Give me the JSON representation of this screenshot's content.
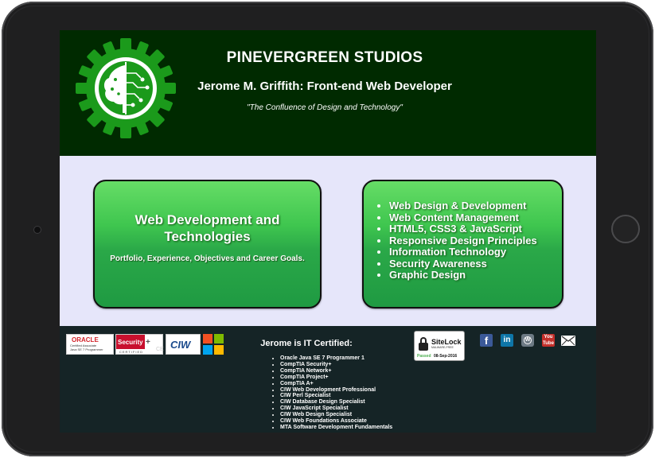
{
  "header": {
    "title": "PINEVERGREEN STUDIOS",
    "subtitle": "Jerome M. Griffith: Front-end Web Developer",
    "tagline": "\"The Confluence of Design and Technology\""
  },
  "panel_left": {
    "title_line1": "Web Development and",
    "title_line2": "Technologies",
    "description": "Portfolio, Experience, Objectives and Career Goals."
  },
  "skills": [
    "Web Design & Development",
    "Web Content Management",
    "HTML5, CSS3 & JavaScript",
    "Responsive Design Principles",
    "Information Technology",
    "Security Awareness",
    "Graphic Design"
  ],
  "footer": {
    "cert_heading": "Jerome is IT Certified:",
    "certifications": [
      "Oracle Java SE 7 Programmer 1",
      "CompTIA Security+",
      "CompTIA Network+",
      "CompTIA Project+",
      "CompTIA A+",
      "CIW Web Development Professional",
      "CIW Perl Specialist",
      "CIW Database Design Specialist",
      "CIW JavaScript Specialist",
      "CIW Web Design Specialist",
      "CIW Web Foundations Associate",
      "MTA Software Development Fundamentals"
    ],
    "badges": {
      "oracle": "ORACLE",
      "oracle_line1": "Certified Associate",
      "oracle_line2": "Java SE 7 Programmer",
      "security": "Security",
      "security_plus": "+",
      "security_cert": "CERTIFIED",
      "ce": "CE",
      "ciw": "CIW"
    },
    "sitelock": {
      "brand": "SiteLock",
      "sub": "MALWARE-FREE",
      "passed": "Passed",
      "date": "08-Sep-2016"
    },
    "social": {
      "facebook": "f",
      "linkedin": "in",
      "wordpress": "W",
      "youtube": "You Tube"
    }
  },
  "colors": {
    "header_bg": "#002a00",
    "content_bg": "#e6e6fa",
    "panel_green": "#3fc64f",
    "footer_bg": "#152426",
    "logo_green": "#1b8f1b"
  },
  "icons": [
    "pinevergreen-gear-tree-logo",
    "facebook-icon",
    "linkedin-icon",
    "wordpress-icon",
    "youtube-icon",
    "mail-icon",
    "padlock-icon",
    "microsoft-logo"
  ]
}
